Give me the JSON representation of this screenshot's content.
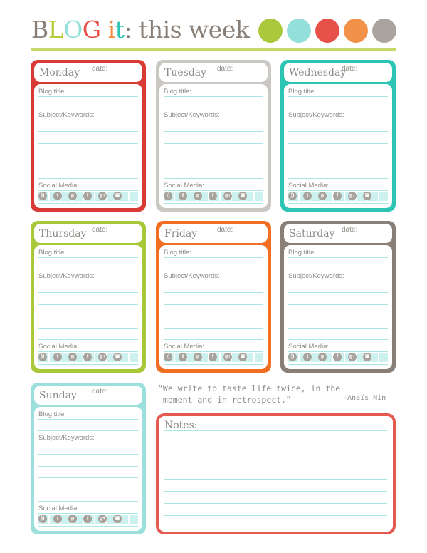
{
  "header": {
    "title_letters": [
      {
        "t": "B",
        "c": "#8a7f76"
      },
      {
        "t": "L",
        "c": "#b5cc3a"
      },
      {
        "t": "O",
        "c": "#8fe0d9"
      },
      {
        "t": "G",
        "c": "#e8514a"
      },
      {
        "t": " ",
        "c": "#8a7f76"
      },
      {
        "t": "i",
        "c": "#f08a3e"
      },
      {
        "t": "t",
        "c": "#2cc4b2"
      },
      {
        "t": ": this week",
        "c": "#8a7f76"
      }
    ],
    "dots": [
      "#a9c83b",
      "#93e0da",
      "#e6524a",
      "#f2914a",
      "#aba49e"
    ]
  },
  "labels": {
    "date": "date:",
    "blog_title": "Blog title:",
    "subject": "Subject/Keywords:",
    "social": "Social Media:",
    "notes": "Notes:"
  },
  "days": [
    {
      "name": "Monday",
      "color": "#d93a35"
    },
    {
      "name": "Tuesday",
      "color": "#cbc8c3"
    },
    {
      "name": "Wednesday",
      "color": "#2cc4b2"
    },
    {
      "name": "Thursday",
      "color": "#a8c83a"
    },
    {
      "name": "Friday",
      "color": "#f26e22"
    },
    {
      "name": "Saturday",
      "color": "#8a7f76"
    },
    {
      "name": "Sunday",
      "color": "#9be0dc"
    }
  ],
  "social_icons": [
    "rss-icon",
    "twitter-icon",
    "pinterest-icon",
    "facebook-icon",
    "google-plus-icon",
    "instagram-icon"
  ],
  "quote": {
    "text": "“We write to taste life twice, in the\n moment and in retrospect.”",
    "author": "-Anaïs Nin"
  }
}
